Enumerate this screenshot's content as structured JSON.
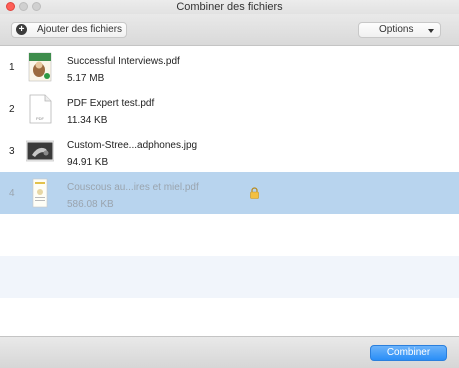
{
  "window": {
    "title": "Combiner des fichiers"
  },
  "toolbar": {
    "add_label": "Ajouter des fichiers",
    "options_label": "Options"
  },
  "files": [
    {
      "index": "1",
      "name": "Successful Interviews.pdf",
      "size": "5.17 MB",
      "icon": "pdf-cover-icon",
      "selected": false,
      "locked": false
    },
    {
      "index": "2",
      "name": "PDF Expert test.pdf",
      "size": "11.34 KB",
      "icon": "pdf-document-icon",
      "selected": false,
      "locked": false
    },
    {
      "index": "3",
      "name": "Custom-Stree...adphones.jpg",
      "size": "94.91 KB",
      "icon": "image-thumbnail-icon",
      "selected": false,
      "locked": false
    },
    {
      "index": "4",
      "name": "Couscous au...ires et miel.pdf",
      "size": "586.08 KB",
      "icon": "pdf-recipe-icon",
      "selected": true,
      "locked": true
    }
  ],
  "footer": {
    "combine_label": "Combiner"
  },
  "colors": {
    "selection": "#b8d4ee",
    "accent": "#2a8ef7",
    "close": "#fe5f57"
  }
}
